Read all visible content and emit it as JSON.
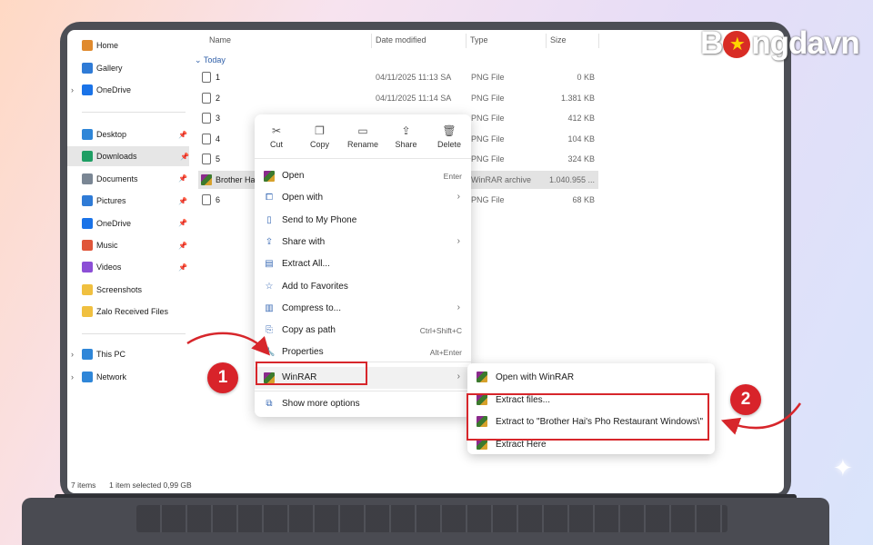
{
  "brand": {
    "logo_prefix": "B",
    "logo_star": "★",
    "logo_suffix": "ngdavn"
  },
  "columns": {
    "name": "Name",
    "date": "Date modified",
    "type": "Type",
    "size": "Size"
  },
  "sidebar": {
    "top": [
      {
        "label": "Home",
        "icon": "home-icon",
        "color": "#e08a2e"
      },
      {
        "label": "Gallery",
        "icon": "gallery-icon",
        "color": "#2f7bd6"
      },
      {
        "label": "OneDrive",
        "icon": "cloud-icon",
        "color": "#1a73e8"
      }
    ],
    "pinned": [
      {
        "label": "Desktop",
        "icon": "desktop-icon",
        "color": "#2f86d8"
      },
      {
        "label": "Downloads",
        "icon": "download-icon",
        "color": "#1e9e64"
      },
      {
        "label": "Documents",
        "icon": "documents-icon",
        "color": "#7a8694"
      },
      {
        "label": "Pictures",
        "icon": "pictures-icon",
        "color": "#2f7bd6"
      },
      {
        "label": "OneDrive",
        "icon": "cloud-icon",
        "color": "#1a73e8"
      },
      {
        "label": "Music",
        "icon": "music-icon",
        "color": "#e0563a"
      },
      {
        "label": "Videos",
        "icon": "videos-icon",
        "color": "#8c4fd6"
      },
      {
        "label": "Screenshots",
        "icon": "folder-icon",
        "color": "#f0c040"
      },
      {
        "label": "Zalo Received Files",
        "icon": "folder-icon",
        "color": "#f0c040"
      }
    ],
    "bottom": [
      {
        "label": "This PC",
        "icon": "pc-icon",
        "color": "#2f86d8"
      },
      {
        "label": "Network",
        "icon": "network-icon",
        "color": "#2f86d8"
      }
    ]
  },
  "group_label": "Today",
  "files": [
    {
      "name": "1",
      "date": "04/11/2025 11:13 SA",
      "type": "PNG File",
      "size": "0 KB"
    },
    {
      "name": "2",
      "date": "04/11/2025 11:14 SA",
      "type": "PNG File",
      "size": "1.381 KB"
    },
    {
      "name": "3",
      "date": "",
      "type": "PNG File",
      "size": "412 KB"
    },
    {
      "name": "4",
      "date": "",
      "type": "PNG File",
      "size": "104 KB"
    },
    {
      "name": "5",
      "date": "",
      "type": "PNG File",
      "size": "324 KB"
    },
    {
      "name": "Brother Ha",
      "date": "",
      "type": "WinRAR archive",
      "size": "1.040.955 ..."
    },
    {
      "name": "6",
      "date": "",
      "type": "PNG File",
      "size": "68 KB"
    }
  ],
  "quick_actions": [
    {
      "label": "Cut",
      "icon": "scissors-icon",
      "glyph": "✂"
    },
    {
      "label": "Copy",
      "icon": "copy-icon",
      "glyph": "❐"
    },
    {
      "label": "Rename",
      "icon": "rename-icon",
      "glyph": "▭"
    },
    {
      "label": "Share",
      "icon": "share-icon",
      "glyph": "⇪"
    },
    {
      "label": "Delete",
      "icon": "trash-icon",
      "glyph": "🗑"
    }
  ],
  "menu": [
    {
      "label": "Open",
      "shortcut": "Enter",
      "arrow": false,
      "icon": "winrar-icon"
    },
    {
      "label": "Open with",
      "shortcut": "",
      "arrow": true,
      "icon": "open-with-icon"
    },
    {
      "label": "Send to My Phone",
      "shortcut": "",
      "arrow": false,
      "icon": "phone-icon"
    },
    {
      "label": "Share with",
      "shortcut": "",
      "arrow": true,
      "icon": "share-with-icon"
    },
    {
      "label": "Extract All...",
      "shortcut": "",
      "arrow": false,
      "icon": "extract-all-icon"
    },
    {
      "label": "Add to Favorites",
      "shortcut": "",
      "arrow": false,
      "icon": "star-icon"
    },
    {
      "label": "Compress to...",
      "shortcut": "",
      "arrow": true,
      "icon": "compress-icon"
    },
    {
      "label": "Copy as path",
      "shortcut": "Ctrl+Shift+C",
      "arrow": false,
      "icon": "copy-path-icon"
    },
    {
      "label": "Properties",
      "shortcut": "Alt+Enter",
      "arrow": false,
      "icon": "wrench-icon"
    }
  ],
  "menu_winrar": {
    "label": "WinRAR",
    "arrow": true
  },
  "menu_more": {
    "label": "Show more options"
  },
  "submenu": [
    {
      "label": "Open with WinRAR"
    },
    {
      "label": "Extract files..."
    },
    {
      "label": "Extract to \"Brother Hai's Pho Restaurant Windows\\\""
    },
    {
      "label": "Extract Here"
    }
  ],
  "status": {
    "count": "7 items",
    "selection": "1 item selected  0,99 GB"
  },
  "annotations": {
    "step1": "1",
    "step2": "2",
    "accent": "#d7262b"
  },
  "glyphs": {
    "chevron": "›",
    "chevron_down": "⌄",
    "pin": "📌",
    "arrow": "›"
  }
}
